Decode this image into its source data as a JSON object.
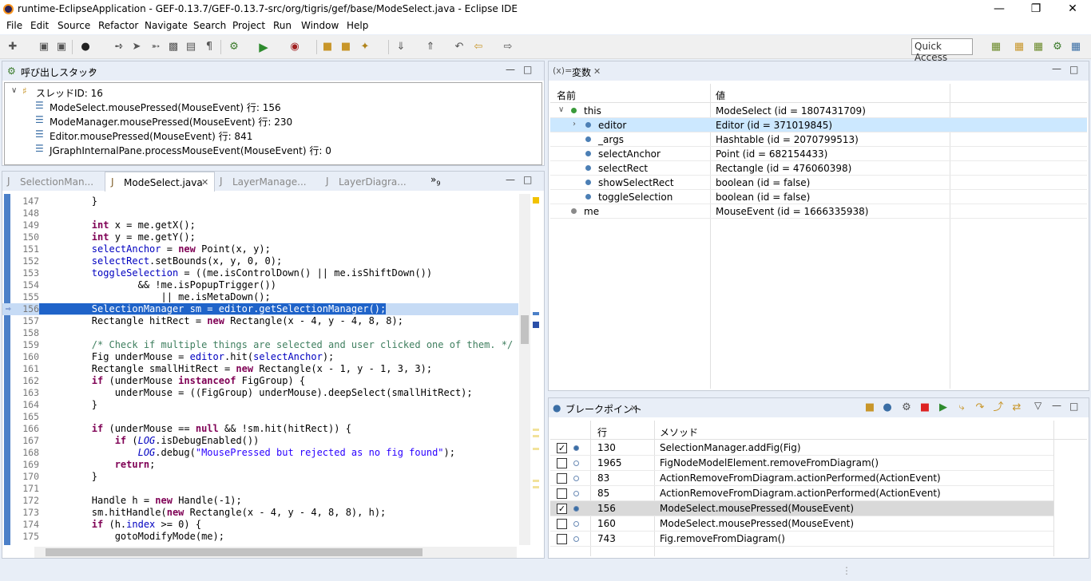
{
  "window": {
    "title": "runtime-EclipseApplication - GEF-0.13.7/GEF-0.13.7-src/org/tigris/gef/base/ModeSelect.java - Eclipse IDE"
  },
  "menu": [
    "File",
    "Edit",
    "Source",
    "Refactor",
    "Navigate",
    "Search",
    "Project",
    "Run",
    "Window",
    "Help"
  ],
  "toolbar": {
    "quick_access": "Quick Access"
  },
  "callstack": {
    "title": "呼び出しスタック",
    "thread": "スレッドID: 16",
    "frames": [
      "ModeSelect.mousePressed(MouseEvent) 行: 156",
      "ModeManager.mousePressed(MouseEvent) 行: 230",
      "Editor.mousePressed(MouseEvent) 行: 841",
      "JGraphInternalPane.processMouseEvent(MouseEvent) 行: 0"
    ]
  },
  "editor": {
    "tabs": [
      "SelectionMan...",
      "ModeSelect.java",
      "LayerManage...",
      "LayerDiagra..."
    ],
    "overflow": "»",
    "overflow_count": "9",
    "lines": [
      {
        "n": "147",
        "c": [
          [
            "",
            "        }"
          ]
        ]
      },
      {
        "n": "148",
        "c": [
          [
            "",
            ""
          ]
        ]
      },
      {
        "n": "149",
        "c": [
          [
            "",
            "        "
          ],
          [
            "kw",
            "int"
          ],
          [
            "",
            " x = me.getX();"
          ]
        ]
      },
      {
        "n": "150",
        "c": [
          [
            "",
            "        "
          ],
          [
            "kw",
            "int"
          ],
          [
            "",
            " y = me.getY();"
          ]
        ]
      },
      {
        "n": "151",
        "c": [
          [
            "",
            "        "
          ],
          [
            "fld",
            "selectAnchor"
          ],
          [
            "",
            " = "
          ],
          [
            "kw",
            "new"
          ],
          [
            "",
            " Point(x, y);"
          ]
        ]
      },
      {
        "n": "152",
        "c": [
          [
            "",
            "        "
          ],
          [
            "fld",
            "selectRect"
          ],
          [
            "",
            ".setBounds(x, y, 0, 0);"
          ]
        ]
      },
      {
        "n": "153",
        "c": [
          [
            "",
            "        "
          ],
          [
            "fld",
            "toggleSelection"
          ],
          [
            "",
            " = ((me.isControlDown() || me.isShiftDown())"
          ]
        ]
      },
      {
        "n": "154",
        "c": [
          [
            "",
            "                && !me.isPopupTrigger())"
          ]
        ]
      },
      {
        "n": "155",
        "c": [
          [
            "",
            "                    || me.isMetaDown();"
          ]
        ]
      },
      {
        "n": "156",
        "c": [
          [
            "",
            "        SelectionManager sm = editor.getSelectionManager();"
          ]
        ],
        "hl": true
      },
      {
        "n": "157",
        "c": [
          [
            "",
            "        Rectangle hitRect = "
          ],
          [
            "kw",
            "new"
          ],
          [
            "",
            " Rectangle(x - 4, y - 4, 8, 8);"
          ]
        ]
      },
      {
        "n": "158",
        "c": [
          [
            "",
            ""
          ]
        ]
      },
      {
        "n": "159",
        "c": [
          [
            "",
            "        "
          ],
          [
            "cmt",
            "/* Check if multiple things are selected and user clicked one of them. */"
          ]
        ]
      },
      {
        "n": "160",
        "c": [
          [
            "",
            "        Fig underMouse = "
          ],
          [
            "fld",
            "editor"
          ],
          [
            "",
            ".hit("
          ],
          [
            "fld",
            "selectAnchor"
          ],
          [
            "",
            ");"
          ]
        ]
      },
      {
        "n": "161",
        "c": [
          [
            "",
            "        Rectangle smallHitRect = "
          ],
          [
            "kw",
            "new"
          ],
          [
            "",
            " Rectangle(x - 1, y - 1, 3, 3);"
          ]
        ]
      },
      {
        "n": "162",
        "c": [
          [
            "",
            "        "
          ],
          [
            "kw",
            "if"
          ],
          [
            "",
            " (underMouse "
          ],
          [
            "kw",
            "instanceof"
          ],
          [
            "",
            " FigGroup) {"
          ]
        ]
      },
      {
        "n": "163",
        "c": [
          [
            "",
            "            underMouse = ((FigGroup) underMouse).deepSelect(smallHitRect);"
          ]
        ]
      },
      {
        "n": "164",
        "c": [
          [
            "",
            "        }"
          ]
        ]
      },
      {
        "n": "165",
        "c": [
          [
            "",
            ""
          ]
        ]
      },
      {
        "n": "166",
        "c": [
          [
            "",
            "        "
          ],
          [
            "kw",
            "if"
          ],
          [
            "",
            " (underMouse == "
          ],
          [
            "kw",
            "null"
          ],
          [
            "",
            " && !sm.hit(hitRect)) {"
          ]
        ]
      },
      {
        "n": "167",
        "c": [
          [
            "",
            "            "
          ],
          [
            "kw",
            "if"
          ],
          [
            "",
            " ("
          ],
          [
            "stat",
            "LOG"
          ],
          [
            "",
            ".isDebugEnabled())"
          ]
        ]
      },
      {
        "n": "168",
        "c": [
          [
            "",
            "                "
          ],
          [
            "stat",
            "LOG"
          ],
          [
            "",
            ".debug("
          ],
          [
            "str",
            "\"MousePressed but rejected as no fig found\""
          ],
          [
            "",
            ");"
          ]
        ]
      },
      {
        "n": "169",
        "c": [
          [
            "",
            "            "
          ],
          [
            "kw",
            "return"
          ],
          [
            "",
            ";"
          ]
        ]
      },
      {
        "n": "170",
        "c": [
          [
            "",
            "        }"
          ]
        ]
      },
      {
        "n": "171",
        "c": [
          [
            "",
            ""
          ]
        ]
      },
      {
        "n": "172",
        "c": [
          [
            "",
            "        Handle h = "
          ],
          [
            "kw",
            "new"
          ],
          [
            "",
            " Handle(-1);"
          ]
        ]
      },
      {
        "n": "173",
        "c": [
          [
            "",
            "        sm.hitHandle("
          ],
          [
            "kw",
            "new"
          ],
          [
            "",
            " Rectangle(x - 4, y - 4, 8, 8), h);"
          ]
        ]
      },
      {
        "n": "174",
        "c": [
          [
            "",
            "        "
          ],
          [
            "kw",
            "if"
          ],
          [
            "",
            " (h."
          ],
          [
            "fld",
            "index"
          ],
          [
            "",
            " >= 0) {"
          ]
        ]
      },
      {
        "n": "175",
        "c": [
          [
            "",
            "            gotoModifyMode(me);"
          ]
        ]
      }
    ]
  },
  "variables": {
    "title": "変数",
    "prefix": "(x)=",
    "col_name": "名前",
    "col_value": "値",
    "rows": [
      {
        "name": "this",
        "value": "ModeSelect (id = 1807431709)",
        "indent": 0,
        "expand": "v",
        "dot": "#3a9a3a"
      },
      {
        "name": "editor",
        "value": "Editor (id = 371019845)",
        "indent": 1,
        "expand": ">",
        "dot": "#4c7fb5",
        "selected": true
      },
      {
        "name": "_args",
        "value": "Hashtable (id = 2070799513)",
        "indent": 1,
        "expand": "",
        "dot": "#4c7fb5"
      },
      {
        "name": "selectAnchor",
        "value": "Point (id = 682154433)",
        "indent": 1,
        "expand": "",
        "dot": "#4c7fb5"
      },
      {
        "name": "selectRect",
        "value": "Rectangle (id = 476060398)",
        "indent": 1,
        "expand": "",
        "dot": "#4c7fb5"
      },
      {
        "name": "showSelectRect",
        "value": "boolean (id = false)",
        "indent": 1,
        "expand": "",
        "dot": "#4c7fb5"
      },
      {
        "name": "toggleSelection",
        "value": "boolean (id = false)",
        "indent": 1,
        "expand": "",
        "dot": "#4c7fb5"
      },
      {
        "name": "me",
        "value": "MouseEvent (id = 1666335938)",
        "indent": 0,
        "expand": "",
        "dot": "#8a8a8a"
      }
    ]
  },
  "breakpoints": {
    "title": "ブレークポイント",
    "col_line": "行",
    "col_method": "メソッド",
    "rows": [
      {
        "line": "130",
        "method": "SelectionManager.addFig(Fig)",
        "checked": true
      },
      {
        "line": "1965",
        "method": "FigNodeModelElement.removeFromDiagram()",
        "checked": false
      },
      {
        "line": "83",
        "method": "ActionRemoveFromDiagram.actionPerformed(ActionEvent)",
        "checked": false
      },
      {
        "line": "85",
        "method": "ActionRemoveFromDiagram.actionPerformed(ActionEvent)",
        "checked": false
      },
      {
        "line": "156",
        "method": "ModeSelect.mousePressed(MouseEvent)",
        "checked": true,
        "selected": true
      },
      {
        "line": "160",
        "method": "ModeSelect.mousePressed(MouseEvent)",
        "checked": false
      },
      {
        "line": "743",
        "method": "Fig.removeFromDiagram()",
        "checked": false
      }
    ]
  }
}
